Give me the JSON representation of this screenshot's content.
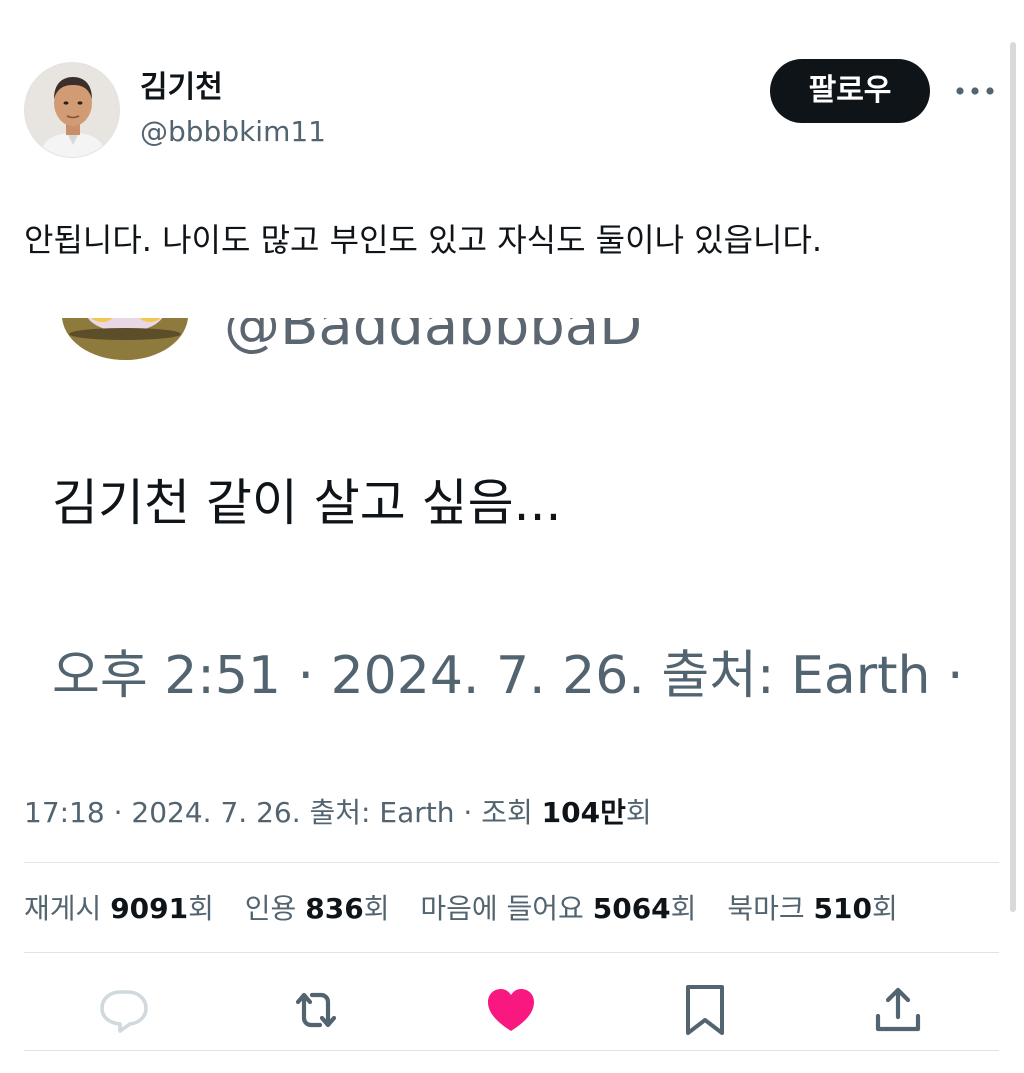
{
  "author": {
    "display_name": "김기천",
    "handle": "@bbbbkim11",
    "avatar_icon": "profile-photo"
  },
  "header": {
    "follow_label": "팔로우",
    "more_icon": "more-horizontal-icon"
  },
  "tweet": {
    "text": "안됩니다. 나이도 많고 부인도 있고 자식도 둘이나 있읍니다."
  },
  "embedded_image": {
    "handle_fragment": "@BaddabbbaD",
    "text": "김기천 같이 살고 싶음...",
    "meta": "오후 2:51 · 2024. 7. 26. 출처: Earth ·"
  },
  "meta": {
    "time": "17:18",
    "date": "2024. 7. 26.",
    "source": "출처: Earth",
    "views_label": "조회",
    "views_count": "104만",
    "views_suffix": "회"
  },
  "stats": {
    "reposts_label": "재게시",
    "reposts_count": "9091",
    "quotes_label": "인용",
    "quotes_count": "836",
    "likes_label": "마음에 들어요",
    "likes_count": "5064",
    "bookmarks_label": "북마크",
    "bookmarks_count": "510",
    "suffix": "회"
  },
  "actions": {
    "reply_icon": "reply-icon",
    "retweet_icon": "retweet-icon",
    "like_icon": "like-heart-icon",
    "bookmark_icon": "bookmark-icon",
    "share_icon": "share-icon"
  },
  "colors": {
    "text_primary": "#0f1419",
    "text_secondary": "#536471",
    "like_active": "#f91880",
    "follow_bg": "#0f1419",
    "divider": "#e1e4e6"
  }
}
